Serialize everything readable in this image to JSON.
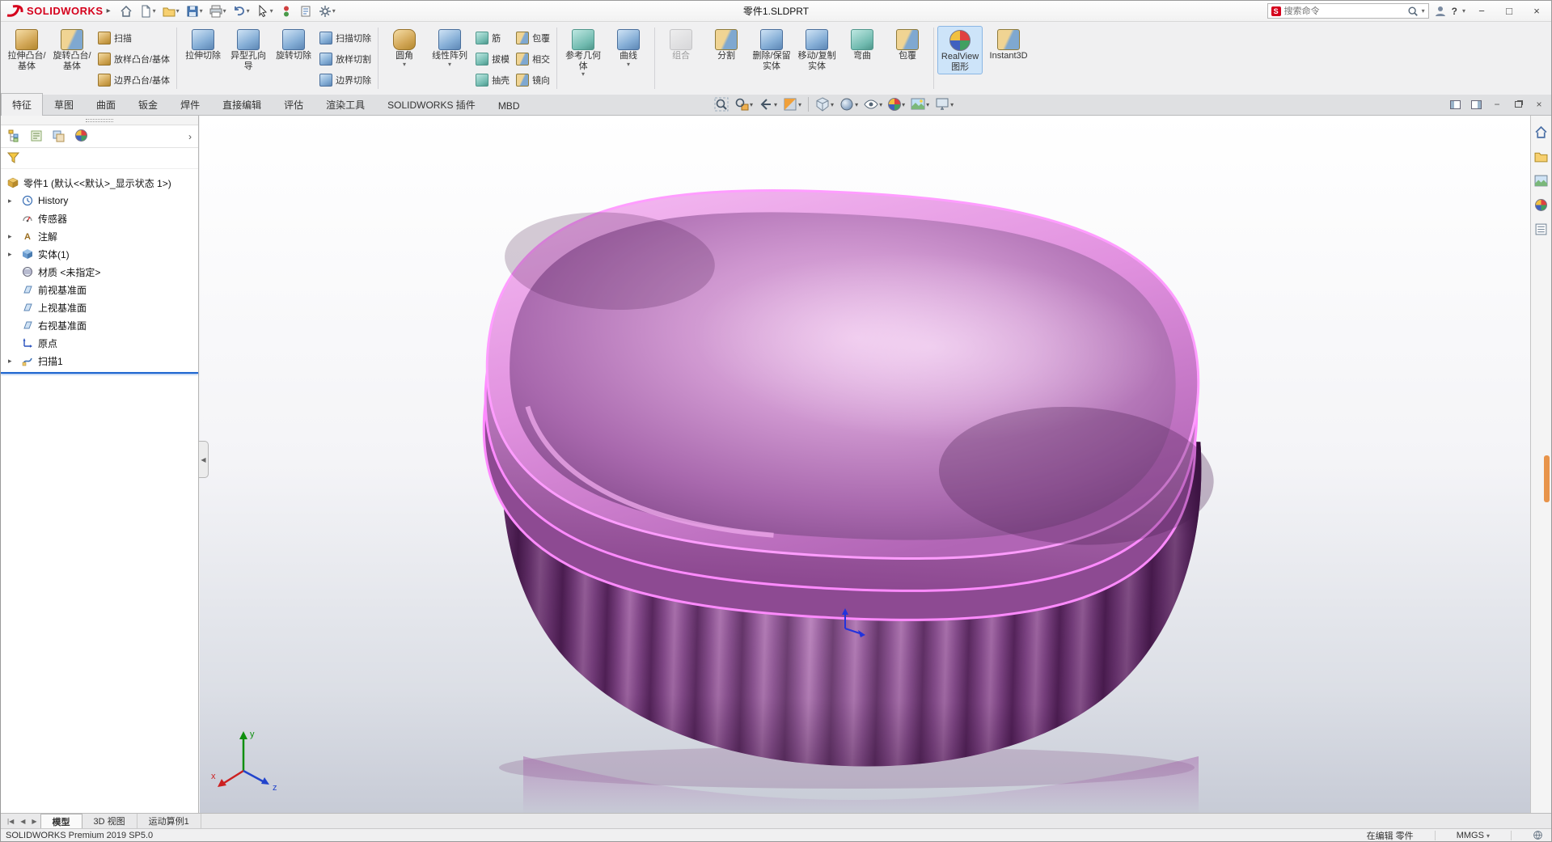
{
  "titlebar": {
    "app_name": "SOLIDWORKS",
    "document_title": "零件1.SLDPRT",
    "search_placeholder": "搜索命令",
    "help": "?"
  },
  "ribbon_tabs": [
    "特征",
    "草图",
    "曲面",
    "钣金",
    "焊件",
    "直接编辑",
    "评估",
    "渲染工具",
    "SOLIDWORKS 插件",
    "MBD"
  ],
  "ribbon": {
    "extrude_boss": "拉伸凸台/基体",
    "revolve_boss": "旋转凸台/基体",
    "swept_boss": "扫描",
    "lofted_boss": "放样凸台/基体",
    "boundary_boss": "边界凸台/基体",
    "extruded_cut": "拉伸切除",
    "hole_wizard": "异型孔向导",
    "revolved_cut": "旋转切除",
    "swept_cut": "扫描切除",
    "lofted_cut": "放样切割",
    "boundary_cut": "边界切除",
    "fillet": "圆角",
    "linear_pattern": "线性阵列",
    "rib": "筋",
    "draft": "拔模",
    "shell": "抽壳",
    "wrap": "包覆",
    "intersect": "相交",
    "mirror": "镜向",
    "reference_geometry": "参考几何体",
    "curves": "曲线",
    "combine": "组合",
    "split": "分割",
    "delete_keep_body": "删除/保留实体",
    "move_copy_body": "移动/复制实体",
    "flex": "弯曲",
    "wrap_body": "包覆",
    "realview": "RealView 图形",
    "instant3d": "Instant3D"
  },
  "tree": {
    "root": "零件1 (默认<<默认>_显示状态 1>)",
    "items": [
      "History",
      "传感器",
      "注解",
      "实体(1)",
      "材质 <未指定>",
      "前视基准面",
      "上视基准面",
      "右视基准面",
      "原点",
      "扫描1"
    ]
  },
  "bottom_tabs": [
    "模型",
    "3D 视图",
    "运动算例1"
  ],
  "statusbar": {
    "product": "SOLIDWORKS Premium 2019 SP5.0",
    "mode": "在编辑 零件",
    "units": "MMGS"
  },
  "triad": {
    "x": "x",
    "y": "y",
    "z": "z"
  },
  "colors": {
    "part_base": "#a95fae",
    "part_rim_highlight": "#ff8bff",
    "rollback_bar": "#1e66d0",
    "realview_active_bg": "#cde4f9"
  }
}
